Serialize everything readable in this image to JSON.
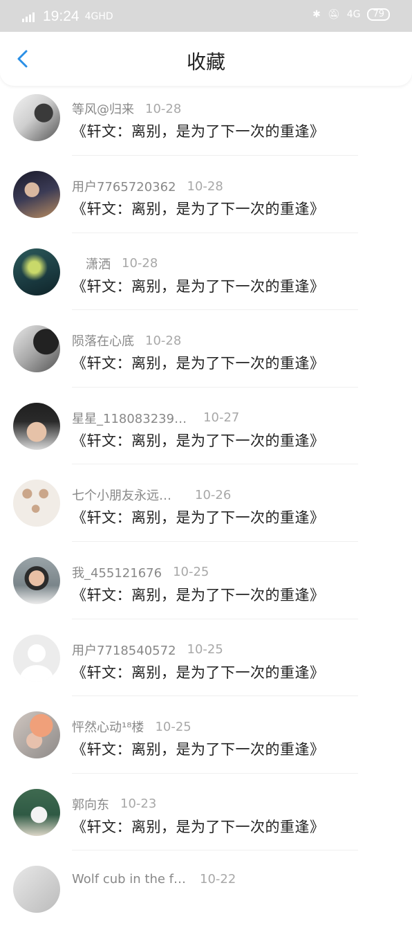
{
  "status_bar": {
    "network": "4GHD",
    "time": "19:24",
    "lte": "4G",
    "battery": "79"
  },
  "header": {
    "title": "收藏"
  },
  "items": [
    {
      "name": "等风@归来",
      "date": "10-28",
      "quote": "《轩文：离别，是为了下一次的重逢》"
    },
    {
      "name": "用户7765720362",
      "date": "10-28",
      "quote": "《轩文：离别，是为了下一次的重逢》"
    },
    {
      "name": "潇洒",
      "date": "10-28",
      "quote": "《轩文：离别，是为了下一次的重逢》"
    },
    {
      "name": "陨落在心底",
      "date": "10-28",
      "quote": "《轩文：离别，是为了下一次的重逢》"
    },
    {
      "name": "星星_118083239…",
      "date": "10-27",
      "quote": "《轩文：离别，是为了下一次的重逢》"
    },
    {
      "name": "七个小朋友永远…",
      "date": "10-26",
      "quote": "《轩文：离别，是为了下一次的重逢》"
    },
    {
      "name": "我_455121676",
      "date": "10-25",
      "quote": "《轩文：离别，是为了下一次的重逢》"
    },
    {
      "name": "用户7718540572",
      "date": "10-25",
      "quote": "《轩文：离别，是为了下一次的重逢》"
    },
    {
      "name": "怦然心动¹⁸楼",
      "date": "10-25",
      "quote": "《轩文：离别，是为了下一次的重逢》"
    },
    {
      "name": "郭向东",
      "date": "10-23",
      "quote": "《轩文：离别，是为了下一次的重逢》"
    },
    {
      "name": "Wolf cub in the f…",
      "date": "10-22",
      "quote": ""
    }
  ],
  "colors": {
    "accent": "#2a8fe6",
    "status_bar_bg": "#d9d9d9"
  }
}
